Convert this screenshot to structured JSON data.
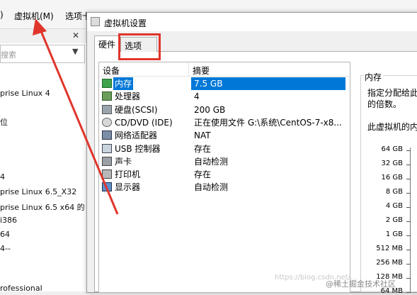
{
  "menubar": {
    "items": [
      ")",
      "虚拟机(M)",
      "选项卡"
    ]
  },
  "library": {
    "search_placeholder": "搜索",
    "vm_items": [
      "prise Linux 4",
      "位",
      "4",
      "prise Linux 6.5_X32",
      "prise Linux 6.5 x64 的",
      "i386",
      "64",
      "4--",
      "rofessional"
    ]
  },
  "dialog": {
    "title": "虚拟机设置",
    "tabs": [
      "硬件",
      "选项"
    ],
    "columns": {
      "device": "设备",
      "summary": "摘要"
    },
    "devices": [
      {
        "name": "内存",
        "summary": "7.5 GB",
        "icon": "memory-icon",
        "selected": true
      },
      {
        "name": "处理器",
        "summary": "4",
        "icon": "processor-icon",
        "selected": false
      },
      {
        "name": "硬盘(SCSI)",
        "summary": "200 GB",
        "icon": "hard-disk-icon",
        "selected": false
      },
      {
        "name": "CD/DVD (IDE)",
        "summary": "正在使用文件 G:\\系统\\CentOS-7-x8...",
        "icon": "cd-dvd-icon",
        "selected": false
      },
      {
        "name": "网络适配器",
        "summary": "NAT",
        "icon": "network-adapter-icon",
        "selected": false
      },
      {
        "name": "USB 控制器",
        "summary": "存在",
        "icon": "usb-controller-icon",
        "selected": false
      },
      {
        "name": "声卡",
        "summary": "自动检测",
        "icon": "sound-card-icon",
        "selected": false
      },
      {
        "name": "打印机",
        "summary": "存在",
        "icon": "printer-icon",
        "selected": false
      },
      {
        "name": "显示器",
        "summary": "自动检测",
        "icon": "display-icon",
        "selected": false
      }
    ],
    "memory": {
      "title": "内存",
      "desc_line1": "指定分配给此",
      "desc_line2": "的倍数。",
      "desc_line3": "此虚拟机的内",
      "scale": [
        "64 GB",
        "32 GB",
        "16 GB",
        "8 GB",
        "4 GB",
        "2 GB",
        "1 GB",
        "512 MB",
        "256 MB",
        "128 MB",
        "64 MB"
      ]
    }
  },
  "annotation": {
    "highlight_color": "#e0352b"
  },
  "watermark": "@稀土掘金技术社区",
  "watermark2": "https://blog.csdn.net/..."
}
